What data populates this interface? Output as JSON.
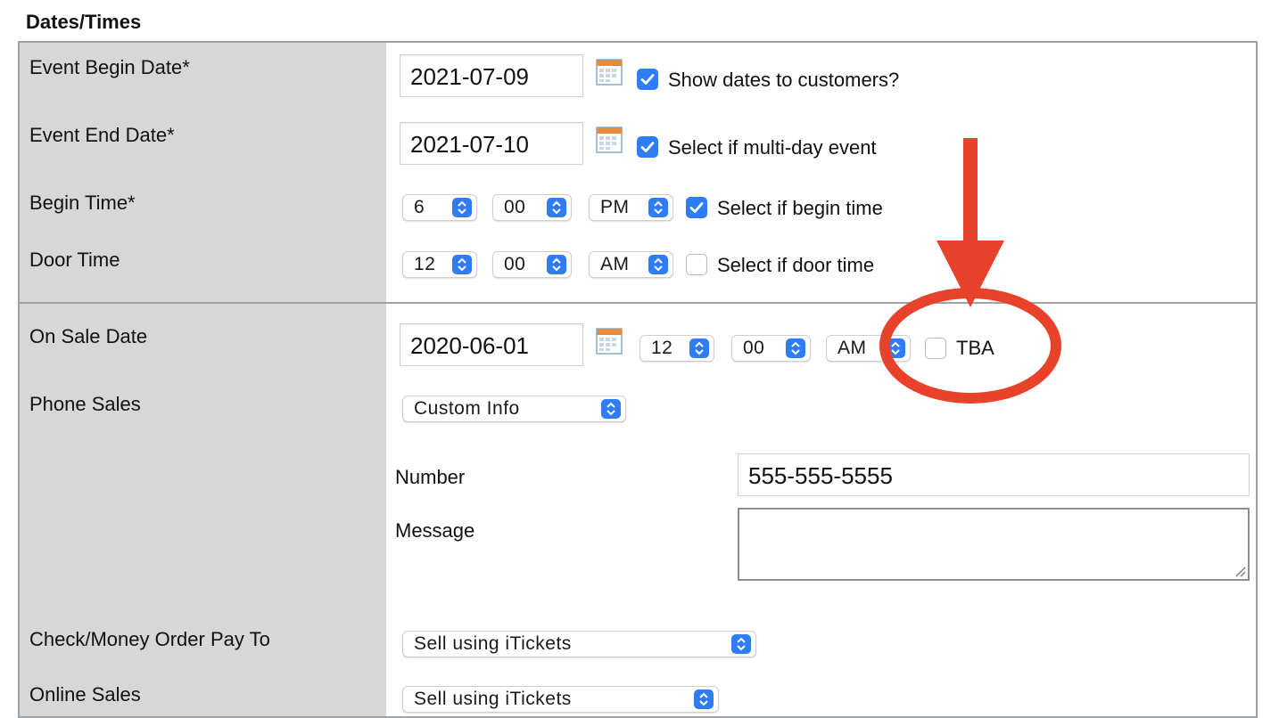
{
  "section": {
    "title": "Dates/Times"
  },
  "labels": {
    "event_begin_date": "Event Begin Date*",
    "event_end_date": "Event End Date*",
    "begin_time": "Begin Time*",
    "door_time": "Door Time",
    "on_sale_date": "On Sale Date",
    "phone_sales": "Phone Sales",
    "check_money_order": "Check/Money Order Pay To",
    "online_sales": "Online Sales"
  },
  "event_begin": {
    "date": "2021-07-09",
    "checkbox_label": "Show dates to customers?",
    "checked": true
  },
  "event_end": {
    "date": "2021-07-10",
    "checkbox_label": "Select if multi-day event",
    "checked": true
  },
  "begin_time": {
    "hour": "6",
    "minute": "00",
    "ampm": "PM",
    "checkbox_label": "Select if begin time",
    "checked": true
  },
  "door_time": {
    "hour": "12",
    "minute": "00",
    "ampm": "AM",
    "checkbox_label": "Select if door time",
    "checked": false
  },
  "on_sale": {
    "date": "2020-06-01",
    "hour": "12",
    "minute": "00",
    "ampm": "AM",
    "tba_label": "TBA",
    "tba_checked": false
  },
  "phone_sales": {
    "selected": "Custom Info",
    "number_label": "Number",
    "number_value": "555-555-5555",
    "message_label": "Message",
    "message_value": ""
  },
  "check_money_order": {
    "selected": "Sell using iTickets"
  },
  "online_sales": {
    "selected": "Sell using iTickets"
  },
  "annotation": {
    "color": "#e8432a",
    "shapes": [
      "arrow-down",
      "circle-highlight"
    ]
  },
  "colors": {
    "accent": "#2f7df6",
    "label_column_bg": "#d7d7d7",
    "border": "#9ea3a8"
  },
  "icons": {
    "calendar": "calendar-icon",
    "stepper": "stepper-icon",
    "check": "checkmark-icon"
  }
}
